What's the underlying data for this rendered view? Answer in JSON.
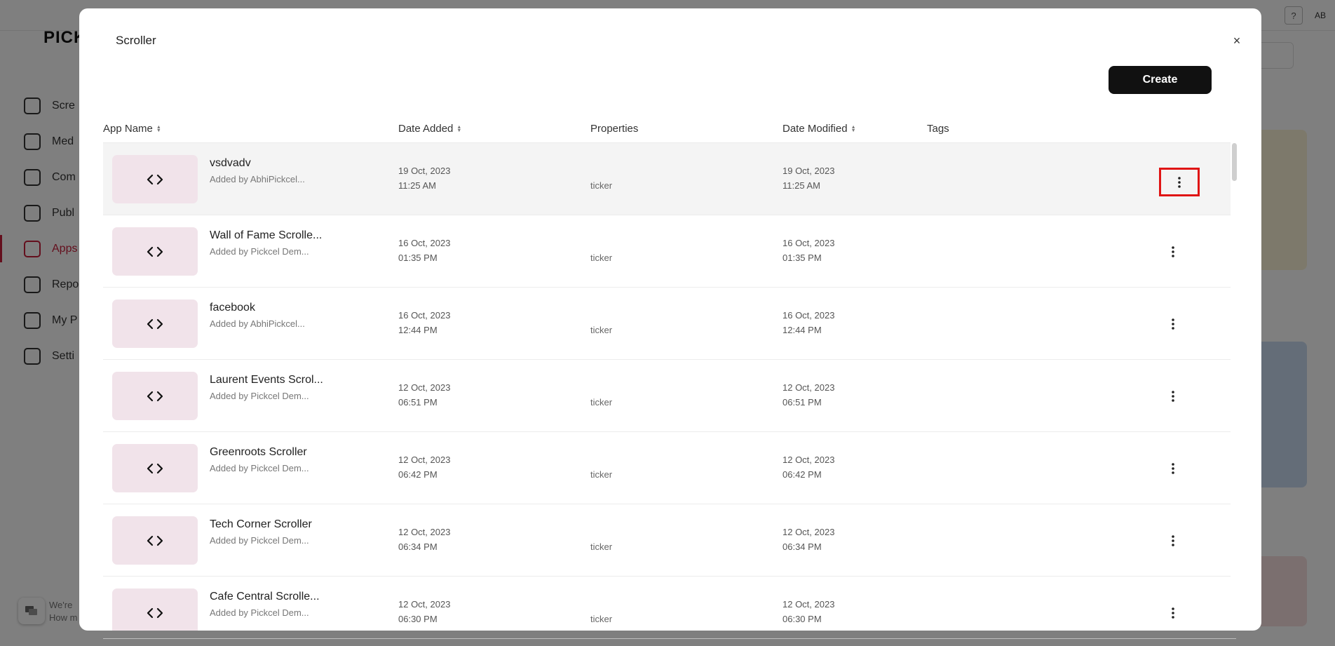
{
  "background": {
    "logo": "PICK",
    "help_label": "?",
    "avatar_initials": "AB",
    "nav": [
      {
        "label": "Scre",
        "icon": "monitor-icon",
        "active": false
      },
      {
        "label": "Med",
        "icon": "folder-icon",
        "active": false
      },
      {
        "label": "Com",
        "icon": "edit-icon",
        "active": false
      },
      {
        "label": "Publ",
        "icon": "calendar-icon",
        "active": false
      },
      {
        "label": "Apps",
        "icon": "grid-icon",
        "active": true
      },
      {
        "label": "Repo",
        "icon": "pie-chart-icon",
        "active": false
      },
      {
        "label": "My P",
        "icon": "ticket-icon",
        "active": false
      },
      {
        "label": "Setti",
        "icon": "gear-icon",
        "active": false
      }
    ],
    "chat": {
      "line1": "We're",
      "line2": "How m"
    }
  },
  "modal": {
    "title": "Scroller",
    "close_label": "×",
    "create_label": "Create",
    "columns": {
      "app_name": "App Name",
      "date_added": "Date Added",
      "properties": "Properties",
      "date_modified": "Date Modified",
      "tags": "Tags"
    },
    "rows": [
      {
        "name": "vsdvadv",
        "added_by": "Added by AbhiPickcel...",
        "added_date": "19 Oct, 2023",
        "added_time": "11:25 AM",
        "property": "ticker",
        "modified_date": "19 Oct, 2023",
        "modified_time": "11:25 AM",
        "selected": true
      },
      {
        "name": "Wall of Fame Scrolle...",
        "added_by": "Added by Pickcel Dem...",
        "added_date": "16 Oct, 2023",
        "added_time": "01:35 PM",
        "property": "ticker",
        "modified_date": "16 Oct, 2023",
        "modified_time": "01:35 PM",
        "selected": false
      },
      {
        "name": "facebook",
        "added_by": "Added by AbhiPickcel...",
        "added_date": "16 Oct, 2023",
        "added_time": "12:44 PM",
        "property": "ticker",
        "modified_date": "16 Oct, 2023",
        "modified_time": "12:44 PM",
        "selected": false
      },
      {
        "name": "Laurent Events Scrol...",
        "added_by": "Added by Pickcel Dem...",
        "added_date": "12 Oct, 2023",
        "added_time": "06:51 PM",
        "property": "ticker",
        "modified_date": "12 Oct, 2023",
        "modified_time": "06:51 PM",
        "selected": false
      },
      {
        "name": "Greenroots Scroller",
        "added_by": "Added by Pickcel Dem...",
        "added_date": "12 Oct, 2023",
        "added_time": "06:42 PM",
        "property": "ticker",
        "modified_date": "12 Oct, 2023",
        "modified_time": "06:42 PM",
        "selected": false
      },
      {
        "name": "Tech Corner Scroller",
        "added_by": "Added by Pickcel Dem...",
        "added_date": "12 Oct, 2023",
        "added_time": "06:34 PM",
        "property": "ticker",
        "modified_date": "12 Oct, 2023",
        "modified_time": "06:34 PM",
        "selected": false
      },
      {
        "name": "Cafe Central Scrolle...",
        "added_by": "Added by Pickcel Dem...",
        "added_date": "12 Oct, 2023",
        "added_time": "06:30 PM",
        "property": "ticker",
        "modified_date": "12 Oct, 2023",
        "modified_time": "06:30 PM",
        "selected": false
      }
    ]
  },
  "colors": {
    "accent": "#c81e3a",
    "highlight_box": "#e01515",
    "thumb_bg": "#f1e3ea",
    "create_bg": "#111111"
  }
}
